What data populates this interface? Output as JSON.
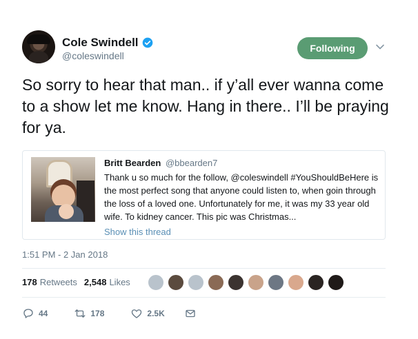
{
  "author": {
    "display_name": "Cole Swindell",
    "handle": "@coleswindell",
    "verified": true,
    "avatar_icon": "avatar"
  },
  "follow_button": {
    "label": "Following",
    "color": "#5a9c73"
  },
  "tweet": {
    "text": "So sorry to hear that man.. if y’all ever wanna come to a show let me know. Hang in there.. I’ll be praying for ya."
  },
  "quoted_tweet": {
    "name": "Britt Bearden",
    "handle": "@bbearden7",
    "text_1": "Thank u so much for the follow, @coleswindell  #YouShouldBeHere is the most perfect song that anyone could listen to, when goin through the loss of a loved one. Unfortunately for me, it was my 33 year old wife. To kidney cancer. This pic was Christmas...",
    "show_thread": "Show this thread"
  },
  "timestamp": "1:51 PM - 2 Jan 2018",
  "stats": {
    "retweets_count": "178",
    "retweets_label": "Retweets",
    "likes_count": "2,548",
    "likes_label": "Likes",
    "liker_avatar_colors": [
      "#b9c3cc",
      "#5b4b3e",
      "#b9c3cc",
      "#8a6a55",
      "#3b3330",
      "#c9a38a",
      "#6d7784",
      "#d9a88d",
      "#2a2422",
      "#1f1a18"
    ]
  },
  "actions": {
    "reply_count": "44",
    "retweet_count": "178",
    "like_count": "2.5K"
  },
  "colors": {
    "link": "#5a8fb5",
    "muted": "#657786",
    "verified_blue": "#1da1f2"
  }
}
